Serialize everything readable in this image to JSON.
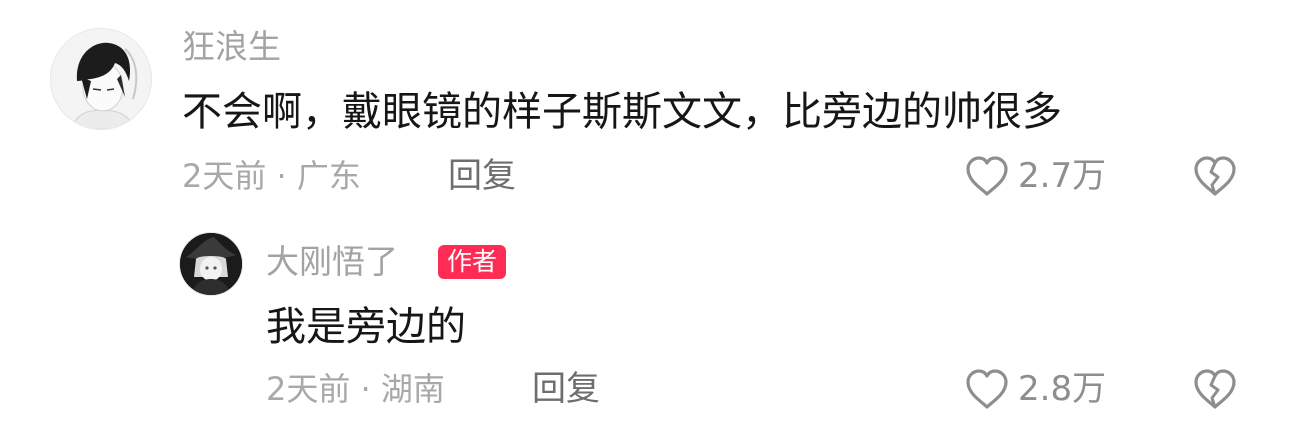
{
  "comments": [
    {
      "username": "狂浪生",
      "content": "不会啊，戴眼镜的样子斯斯文文，比旁边的帅很多",
      "meta": "2天前 · 广东",
      "reply_label": "回复",
      "likes": "2.7万",
      "avatar_icon": "user-avatar-sketch",
      "like_icon": "heart-outline-icon",
      "dislike_icon": "broken-heart-icon"
    },
    {
      "username": "大刚悟了",
      "badge": "作者",
      "content": "我是旁边的",
      "meta": "2天前 · 湖南",
      "reply_label": "回复",
      "likes": "2.8万",
      "avatar_icon": "user-avatar-dark",
      "like_icon": "heart-outline-icon",
      "dislike_icon": "broken-heart-icon"
    }
  ],
  "colors": {
    "username": "#a3a3a3",
    "content": "#161616",
    "meta": "#a8a8a8",
    "reply": "#6e6e6e",
    "badge": "#fe2c55"
  }
}
